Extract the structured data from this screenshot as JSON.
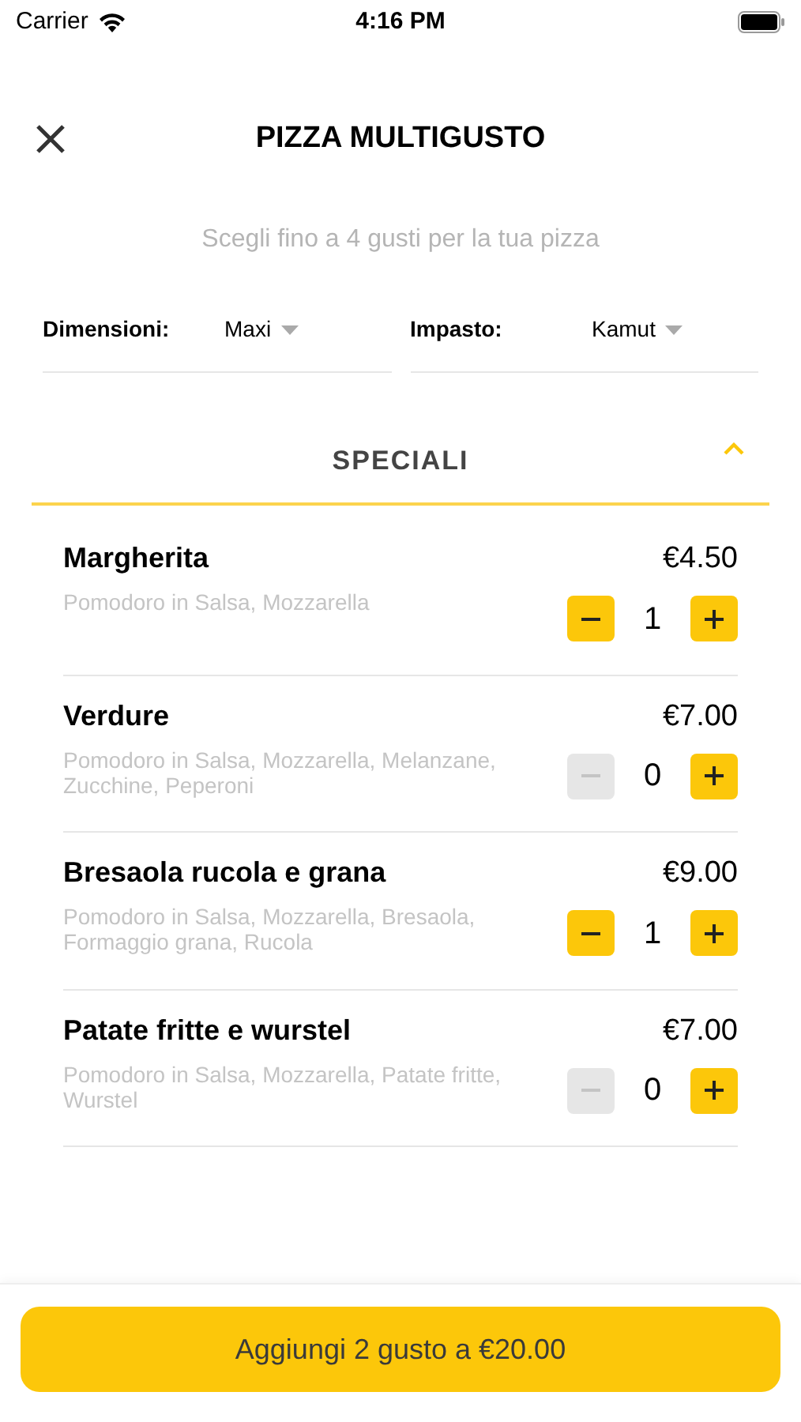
{
  "status_bar": {
    "carrier": "Carrier",
    "time": "4:16 PM"
  },
  "header": {
    "title": "PIZZA MULTIGUSTO"
  },
  "subtitle": "Scegli fino a 4 gusti per la tua pizza",
  "selectors": [
    {
      "label": "Dimensioni:",
      "value": "Maxi"
    },
    {
      "label": "Impasto:",
      "value": "Kamut"
    }
  ],
  "section": {
    "title": "SPECIALI",
    "expanded": true
  },
  "items": [
    {
      "name": "Margherita",
      "price": "€4.50",
      "ingredients": "Pomodoro in Salsa, Mozzarella",
      "quantity": "1",
      "minus_disabled": false
    },
    {
      "name": "Verdure",
      "price": "€7.00",
      "ingredients": "Pomodoro in Salsa, Mozzarella, Melanzane, Zucchine, Peperoni",
      "quantity": "0",
      "minus_disabled": true
    },
    {
      "name": "Bresaola rucola e grana",
      "price": "€9.00",
      "ingredients": "Pomodoro in Salsa, Mozzarella, Bresaola, Formaggio grana, Rucola",
      "quantity": "1",
      "minus_disabled": false
    },
    {
      "name": "Patate fritte e wurstel",
      "price": "€7.00",
      "ingredients": "Pomodoro in Salsa, Mozzarella, Patate fritte, Wurstel",
      "quantity": "0",
      "minus_disabled": true
    }
  ],
  "add_button": "Aggiungi 2 gusto a €20.00"
}
